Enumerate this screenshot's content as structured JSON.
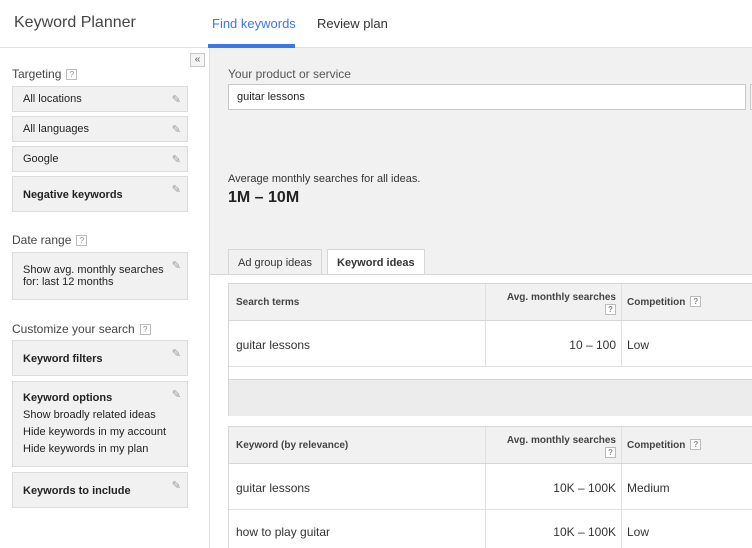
{
  "header": {
    "app_title": "Keyword Planner",
    "tabs": [
      {
        "label": "Find keywords",
        "active": true
      },
      {
        "label": "Review plan",
        "active": false
      }
    ],
    "accent_color": "#3b78e7"
  },
  "sidebar": {
    "collapse_glyph": "«",
    "targeting": {
      "label": "Targeting",
      "items": [
        {
          "label": "All locations"
        },
        {
          "label": "All languages"
        },
        {
          "label": "Google"
        },
        {
          "label": "Negative keywords"
        }
      ]
    },
    "date_range": {
      "label": "Date range",
      "line1": "Show avg. monthly searches",
      "line2": "for: last 12 months"
    },
    "customize": {
      "label": "Customize your search",
      "keyword_filters": "Keyword filters",
      "keyword_options": {
        "title": "Keyword options",
        "lines": [
          "Show broadly related ideas",
          "Hide keywords in my account",
          "Hide keywords in my plan"
        ]
      },
      "keywords_to_include": "Keywords to include"
    },
    "help_glyph": "?",
    "edit_icon": "pencil-icon"
  },
  "main": {
    "product_label": "Your product or service",
    "product_value": "guitar lessons",
    "avg_label": "Average monthly searches for all ideas.",
    "avg_value": "1M – 10M",
    "result_tabs": [
      {
        "label": "Ad group ideas",
        "active": false
      },
      {
        "label": "Keyword ideas",
        "active": true
      }
    ],
    "search_terms_table": {
      "headers": [
        "Search terms",
        "Avg. monthly searches",
        "Competition"
      ],
      "rows": [
        {
          "term": "guitar lessons",
          "searches": "10 – 100",
          "competition": "Low"
        }
      ]
    },
    "keyword_table": {
      "headers": [
        "Keyword (by relevance)",
        "Avg. monthly searches",
        "Competition"
      ],
      "rows": [
        {
          "term": "guitar lessons",
          "searches": "10K – 100K",
          "competition": "Medium"
        },
        {
          "term": "how to play guitar",
          "searches": "10K – 100K",
          "competition": "Low"
        }
      ]
    }
  }
}
